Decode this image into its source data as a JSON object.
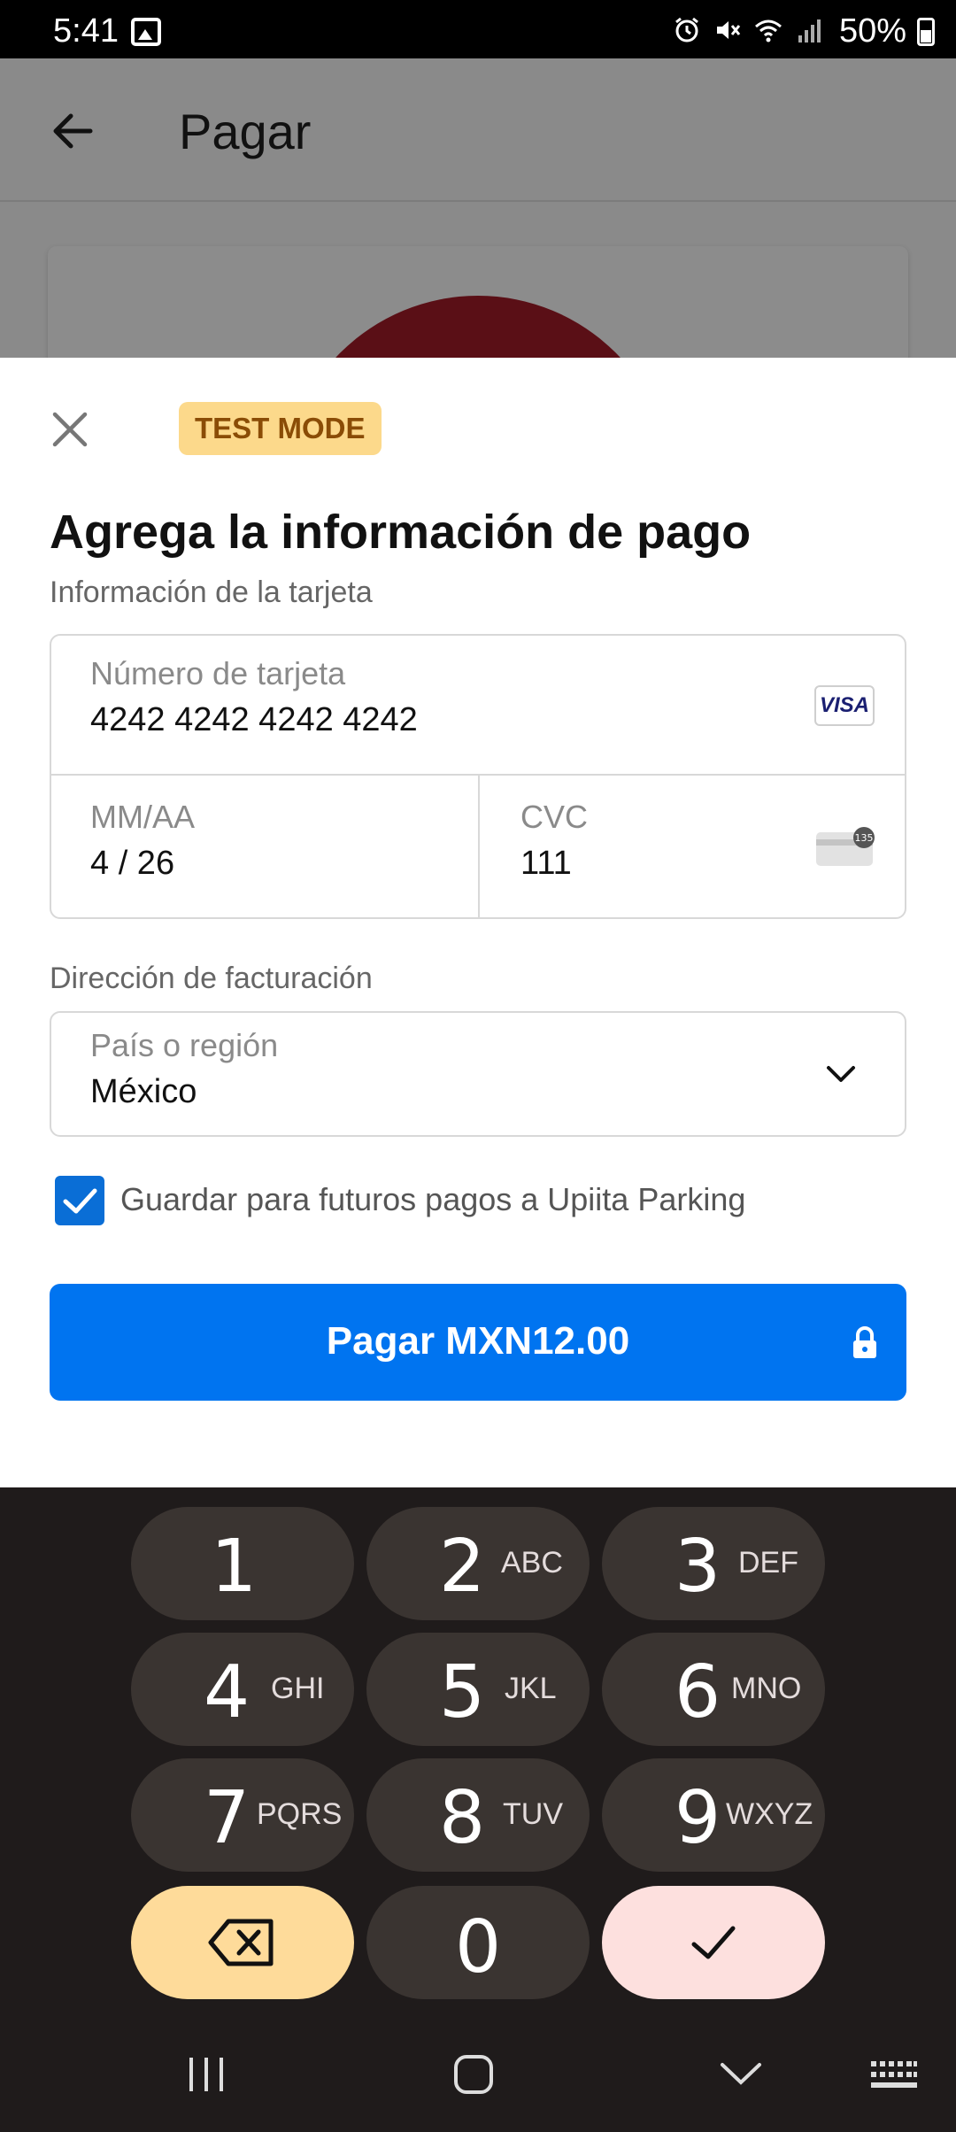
{
  "status": {
    "time": "5:41",
    "battery": "50%"
  },
  "appbar": {
    "title": "Pagar"
  },
  "sheet": {
    "badge": "TEST MODE",
    "title": "Agrega la información de pago",
    "card_section_label": "Información de la tarjeta",
    "card_number_label": "Número de tarjeta",
    "card_number_value": "4242 4242 4242 4242",
    "card_brand": "VISA",
    "expiry_label": "MM/AA",
    "expiry_value": "4 / 26",
    "cvc_label": "CVC",
    "cvc_value": "111",
    "cvc_icon_text": "135",
    "billing_section_label": "Dirección de facturación",
    "country_label": "País o región",
    "country_value": "México",
    "save_label": "Guardar para futuros pagos a Upiita Parking",
    "save_checked": true,
    "pay_label": "Pagar MXN12.00"
  },
  "keyboard": {
    "keys": [
      {
        "num": "1",
        "letters": ""
      },
      {
        "num": "2",
        "letters": "ABC"
      },
      {
        "num": "3",
        "letters": "DEF"
      },
      {
        "num": "4",
        "letters": "GHI"
      },
      {
        "num": "5",
        "letters": "JKL"
      },
      {
        "num": "6",
        "letters": "MNO"
      },
      {
        "num": "7",
        "letters": "PQRS"
      },
      {
        "num": "8",
        "letters": "TUV"
      },
      {
        "num": "9",
        "letters": "WXYZ"
      },
      {
        "num": "0",
        "letters": ""
      }
    ]
  },
  "colors": {
    "primary": "#0074f0",
    "badge_bg": "#fcd98b",
    "badge_text": "#8a4c06",
    "keyboard_bg": "#1f1b1b",
    "key_bg": "#3a3431"
  }
}
